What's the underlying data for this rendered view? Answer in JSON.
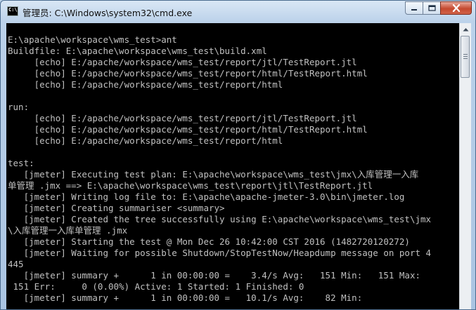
{
  "window": {
    "title": "管理员: C:\\Windows\\system32\\cmd.exe",
    "icon": "cmd-icon",
    "icon_label": "C:\\",
    "buttons": [
      "minimize-icon",
      "maximize-icon",
      "close-icon"
    ]
  },
  "console": {
    "lines": [
      "",
      "E:\\apache\\workspace\\wms_test>ant",
      "Buildfile: E:\\apache\\workspace\\wms_test\\build.xml",
      "     [echo] E:/apache/workspace/wms_test/report/jtl/TestReport.jtl",
      "     [echo] E:/apache/workspace/wms_test/report/html/TestReport.html",
      "     [echo] E:/apache/workspace/wms_test/report/html",
      "",
      "run:",
      "     [echo] E:/apache/workspace/wms_test/report/jtl/TestReport.jtl",
      "     [echo] E:/apache/workspace/wms_test/report/html/TestReport.html",
      "     [echo] E:/apache/workspace/wms_test/report/html",
      "",
      "test:",
      "   [jmeter] Executing test plan: E:\\apache\\workspace\\wms_test\\jmx\\入库管理一入库",
      "单管理 .jmx ==> E:\\apache\\workspace\\wms_test\\report\\jtl\\TestReport.jtl",
      "   [jmeter] Writing log file to: E:\\apache\\apache-jmeter-3.0\\bin\\jmeter.log",
      "   [jmeter] Creating summariser <summary>",
      "   [jmeter] Created the tree successfully using E:\\apache\\workspace\\wms_test\\jmx",
      "\\入库管理一入库单管理 .jmx",
      "   [jmeter] Starting the test @ Mon Dec 26 10:42:00 CST 2016 (1482720120272)",
      "   [jmeter] Waiting for possible Shutdown/StopTestNow/Heapdump message on port 4",
      "445",
      "   [jmeter] summary +      1 in 00:00:00 =    3.4/s Avg:   151 Min:   151 Max:",
      " 151 Err:     0 (0.00%) Active: 1 Started: 1 Finished: 0",
      "   [jmeter] summary +      1 in 00:00:00 =   10.1/s Avg:    82 Min:"
    ]
  },
  "colors": {
    "console_bg": "#000000",
    "console_fg": "#c0c0c0",
    "close_red": "#c5492f",
    "frame": "#bcd2ea"
  }
}
